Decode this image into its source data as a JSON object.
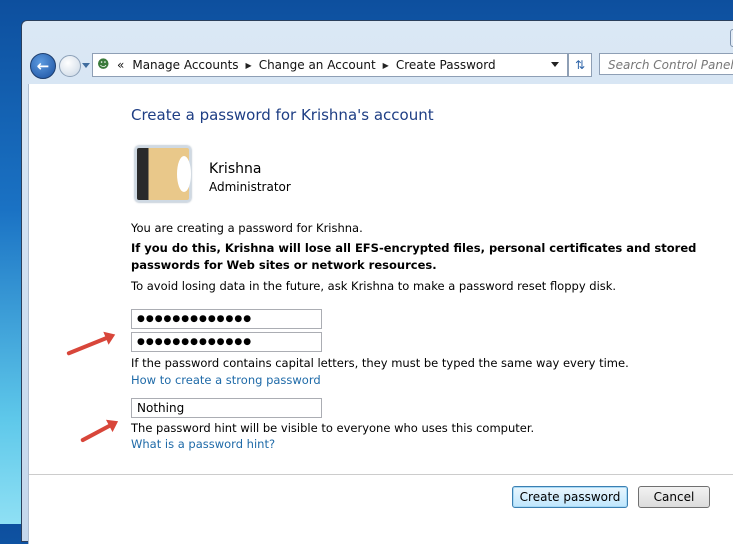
{
  "nav": {
    "breadcrumb": [
      "Manage Accounts",
      "Change an Account",
      "Create Password"
    ],
    "overflow": "«",
    "search_placeholder": "Search Control Panel"
  },
  "page": {
    "title": "Create a password for Krishna's account",
    "user_name": "Krishna",
    "user_role": "Administrator",
    "info": "You are creating a password for Krishna.",
    "warning": "If you do this, Krishna will lose all EFS-encrypted files, personal certificates and stored passwords for Web sites or network resources.",
    "advice": "To avoid losing data in the future, ask Krishna to make a password reset floppy disk.",
    "password": "●●●●●●●●●●●●●",
    "confirm": "●●●●●●●●●●●●●",
    "caps_note": "If the password contains capital letters, they must be typed the same way every time.",
    "strong_link": "How to create a strong password",
    "hint": "Nothing",
    "hint_note": "The password hint will be visible to everyone who uses this computer.",
    "hint_link": "What is a password hint?"
  },
  "buttons": {
    "create": "Create password",
    "cancel": "Cancel"
  },
  "colors": {
    "title": "#1e3e84",
    "link": "#1e6aa8",
    "annotation_arrow": "#d8463a"
  }
}
